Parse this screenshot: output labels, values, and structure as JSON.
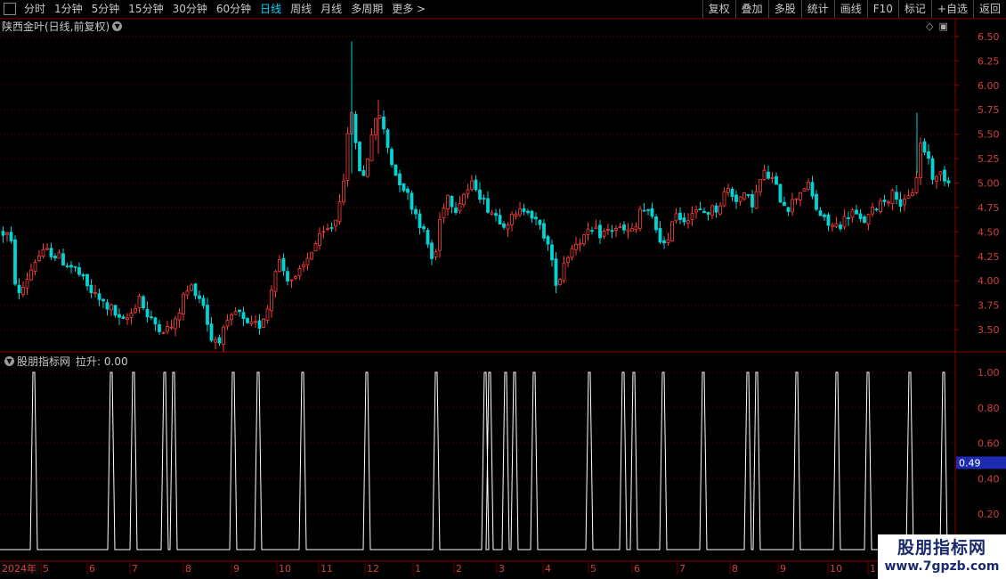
{
  "toolbar": {
    "periods": [
      "分时",
      "1分钟",
      "5分钟",
      "15分钟",
      "30分钟",
      "60分钟",
      "日线",
      "周线",
      "月线",
      "多周期",
      "更多 >"
    ],
    "active_period": "日线",
    "right_buttons": [
      "复权",
      "叠加",
      "多股",
      "统计",
      "画线",
      "F10",
      "标记",
      "+自选",
      "返回"
    ]
  },
  "main_chart": {
    "title": "陕西金叶(日线,前复权)",
    "price_ticks": [
      "6.50",
      "6.25",
      "6.00",
      "5.75",
      "5.50",
      "5.25",
      "5.00",
      "4.75",
      "4.50",
      "4.25",
      "4.00",
      "3.75",
      "3.50"
    ],
    "price_tick_values": [
      6.5,
      6.25,
      6.0,
      5.75,
      5.5,
      5.25,
      5.0,
      4.75,
      4.5,
      4.25,
      4.0,
      3.75,
      3.5
    ],
    "ylim": [
      3.3,
      6.6
    ],
    "up_color": "#ff3c3c",
    "down_color": "#00d4d4"
  },
  "sub_chart": {
    "title": "股朋指标网",
    "indicator_label": "拉升: 0.00",
    "ticks": [
      "1.00",
      "0.80",
      "0.60",
      "0.40",
      "0.20"
    ],
    "tick_values": [
      1.0,
      0.8,
      0.6,
      0.4,
      0.2
    ],
    "ylim": [
      0,
      1.05
    ],
    "cursor_value": "0.49",
    "cursor_value_num": 0.49,
    "line_color": "#ffffff"
  },
  "x_axis": {
    "year_label": "2024年",
    "month_labels": [
      "5",
      "6",
      "7",
      "8",
      "9",
      "10",
      "11",
      "12",
      "1",
      "2",
      "3",
      "4",
      "5",
      "6",
      "7",
      "8",
      "9",
      "10",
      "1"
    ]
  },
  "chart_data": {
    "type": "candlestick",
    "keypoints": [
      [
        0,
        4.5
      ],
      [
        10,
        4.45
      ],
      [
        18,
        3.8
      ],
      [
        25,
        3.95
      ],
      [
        40,
        4.25
      ],
      [
        55,
        4.3
      ],
      [
        70,
        4.2
      ],
      [
        85,
        4.1
      ],
      [
        95,
        3.95
      ],
      [
        110,
        3.8
      ],
      [
        125,
        3.7
      ],
      [
        135,
        3.55
      ],
      [
        145,
        3.65
      ],
      [
        155,
        3.85
      ],
      [
        165,
        3.6
      ],
      [
        175,
        3.55
      ],
      [
        185,
        3.5
      ],
      [
        195,
        3.55
      ],
      [
        205,
        3.85
      ],
      [
        215,
        3.95
      ],
      [
        228,
        3.75
      ],
      [
        235,
        3.4
      ],
      [
        245,
        3.42
      ],
      [
        255,
        3.55
      ],
      [
        265,
        3.7
      ],
      [
        275,
        3.52
      ],
      [
        290,
        3.55
      ],
      [
        300,
        3.75
      ],
      [
        310,
        4.25
      ],
      [
        320,
        4.05
      ],
      [
        330,
        4.0
      ],
      [
        340,
        4.15
      ],
      [
        350,
        4.35
      ],
      [
        360,
        4.45
      ],
      [
        375,
        4.6
      ],
      [
        385,
        5.1
      ],
      [
        393,
        5.8
      ],
      [
        400,
        5.2
      ],
      [
        408,
        5.05
      ],
      [
        415,
        5.5
      ],
      [
        425,
        5.7
      ],
      [
        433,
        5.4
      ],
      [
        442,
        5.1
      ],
      [
        450,
        5.0
      ],
      [
        460,
        4.8
      ],
      [
        470,
        4.6
      ],
      [
        478,
        4.4
      ],
      [
        486,
        4.15
      ],
      [
        492,
        4.6
      ],
      [
        500,
        4.9
      ],
      [
        510,
        4.75
      ],
      [
        520,
        4.9
      ],
      [
        532,
        5.0
      ],
      [
        542,
        4.8
      ],
      [
        552,
        4.7
      ],
      [
        565,
        4.6
      ],
      [
        578,
        4.65
      ],
      [
        590,
        4.78
      ],
      [
        600,
        4.6
      ],
      [
        612,
        4.45
      ],
      [
        620,
        4.1
      ],
      [
        625,
        3.95
      ],
      [
        632,
        4.2
      ],
      [
        645,
        4.4
      ],
      [
        655,
        4.45
      ],
      [
        665,
        4.5
      ],
      [
        675,
        4.48
      ],
      [
        690,
        4.55
      ],
      [
        700,
        4.5
      ],
      [
        712,
        4.5
      ],
      [
        718,
        4.75
      ],
      [
        730,
        4.65
      ],
      [
        742,
        4.4
      ],
      [
        748,
        4.3
      ],
      [
        755,
        4.75
      ],
      [
        765,
        4.62
      ],
      [
        775,
        4.7
      ],
      [
        790,
        4.7
      ],
      [
        805,
        4.75
      ],
      [
        815,
        4.95
      ],
      [
        825,
        4.85
      ],
      [
        835,
        4.85
      ],
      [
        845,
        4.8
      ],
      [
        855,
        5.1
      ],
      [
        865,
        5.05
      ],
      [
        875,
        4.85
      ],
      [
        885,
        4.75
      ],
      [
        895,
        4.9
      ],
      [
        905,
        5.0
      ],
      [
        915,
        4.75
      ],
      [
        925,
        4.6
      ],
      [
        935,
        4.55
      ],
      [
        945,
        4.6
      ],
      [
        955,
        4.72
      ],
      [
        965,
        4.6
      ],
      [
        975,
        4.65
      ],
      [
        985,
        4.8
      ],
      [
        995,
        4.85
      ],
      [
        1005,
        4.9
      ],
      [
        1012,
        4.75
      ],
      [
        1020,
        4.85
      ],
      [
        1027,
        5.0
      ],
      [
        1032,
        5.4
      ],
      [
        1040,
        5.3
      ],
      [
        1048,
        5.0
      ],
      [
        1055,
        5.1
      ],
      [
        1062,
        5.05
      ],
      [
        1068,
        4.95
      ]
    ],
    "spike_days": [
      38,
      125,
      150,
      185,
      195,
      262,
      290,
      340,
      412,
      490,
      545,
      550,
      568,
      578,
      600,
      662,
      700,
      712,
      745,
      790,
      840,
      850,
      895,
      940,
      975,
      1022,
      1060
    ],
    "spike_value": 1.0
  }
}
